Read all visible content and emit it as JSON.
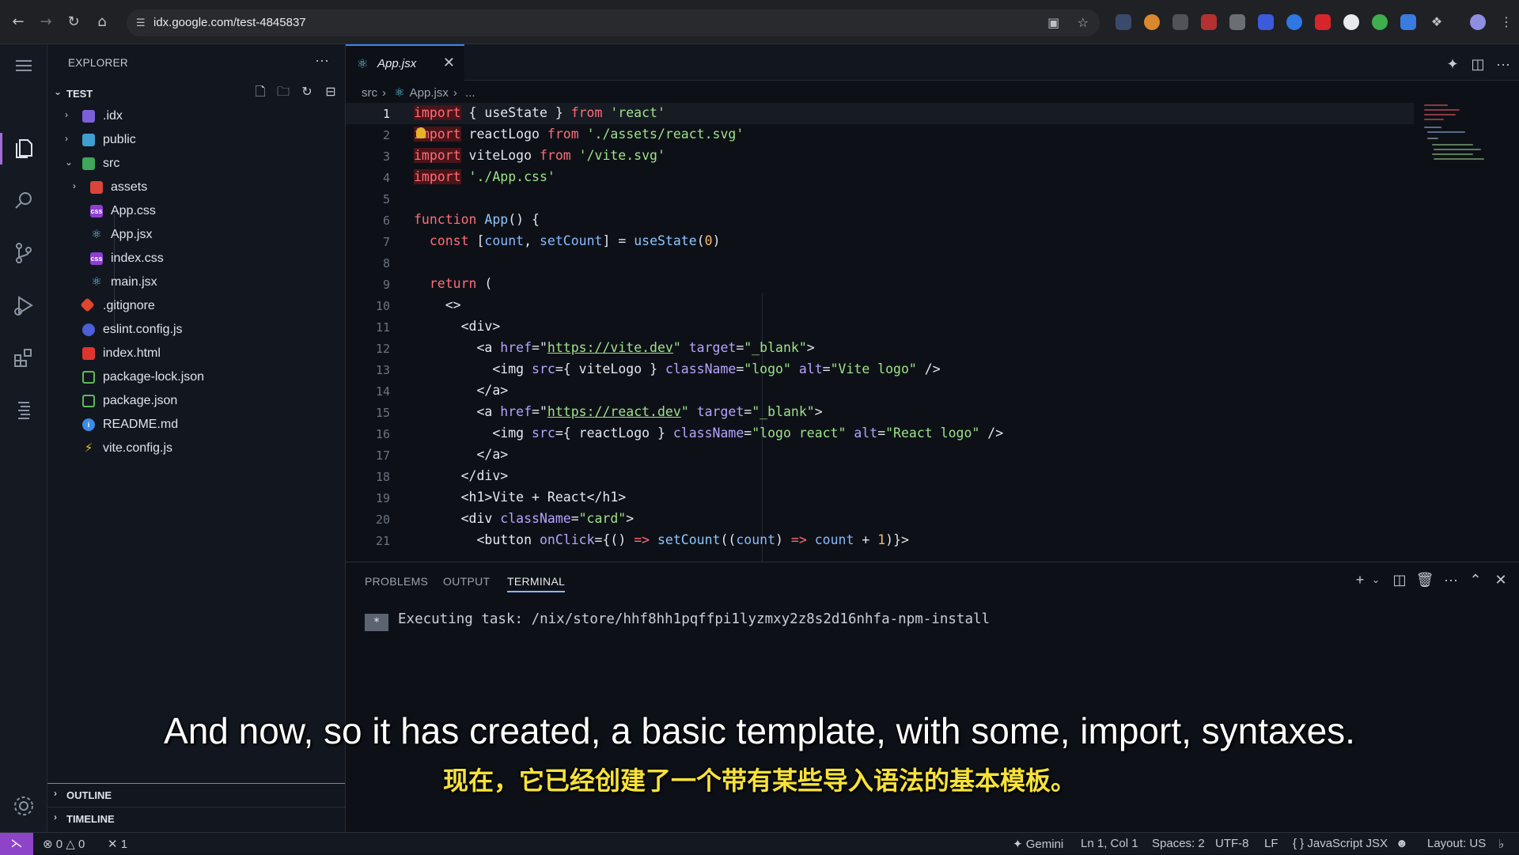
{
  "browser": {
    "url": "idx.google.com/test-4845837"
  },
  "explorer": {
    "title": "EXPLORER",
    "root": "TEST",
    "items": [
      {
        "label": ".idx",
        "type": "folder"
      },
      {
        "label": "public",
        "type": "folder"
      },
      {
        "label": "src",
        "type": "folder-open"
      },
      {
        "label": "assets",
        "type": "folder"
      },
      {
        "label": "App.css",
        "type": "css"
      },
      {
        "label": "App.jsx",
        "type": "react"
      },
      {
        "label": "index.css",
        "type": "css"
      },
      {
        "label": "main.jsx",
        "type": "react"
      },
      {
        "label": ".gitignore",
        "type": "git"
      },
      {
        "label": "eslint.config.js",
        "type": "eslint"
      },
      {
        "label": "index.html",
        "type": "html"
      },
      {
        "label": "package-lock.json",
        "type": "node"
      },
      {
        "label": "package.json",
        "type": "node"
      },
      {
        "label": "README.md",
        "type": "info"
      },
      {
        "label": "vite.config.js",
        "type": "vite"
      }
    ],
    "outline": "OUTLINE",
    "timeline": "TIMELINE"
  },
  "editor": {
    "tab": "App.jsx",
    "breadcrumb": [
      "src",
      "App.jsx",
      "..."
    ],
    "line_numbers": [
      "1",
      "2",
      "3",
      "4",
      "5",
      "6",
      "7",
      "8",
      "9",
      "10",
      "11",
      "12",
      "13",
      "14",
      "15",
      "16",
      "17",
      "18",
      "19",
      "20",
      "21"
    ],
    "strings": {
      "import": "import",
      "from": "from",
      "useState_import": " { useState } ",
      "react": "'react'",
      "reactLogo": " reactLogo ",
      "react_svg": "'./assets/react.svg'",
      "viteLogo": " viteLogo ",
      "vite_svg": "'/vite.svg'",
      "app_css": "'./App.css'",
      "function": "function",
      "App": "App",
      "fn_tail": "() {",
      "const": "const",
      "count": "count",
      "setCount": "setCount",
      "useState": "useState",
      "zero": "0",
      "return": "return",
      "frag": "<>",
      "div_open": "<div>",
      "a": "<a",
      "href": "href",
      "vite_url": "https://vite.dev",
      "react_url": "https://react.dev",
      "target": "target",
      "blank": "\"_blank\"",
      "img": "<img",
      "src": "src",
      "className": "className",
      "alt": "alt",
      "logo": "\"logo\"",
      "logo_react": "\"logo react\"",
      "vite_alt": "\"Vite logo\"",
      "react_alt": "\"React logo\"",
      "a_close": "</a>",
      "div_close": "</div>",
      "h1_text": "<h1>Vite + React</h1>",
      "div_card_open": "<div ",
      "card": "\"card\"",
      "button": "<button",
      "onClick": "onClick",
      "one": "1"
    }
  },
  "panel": {
    "tabs": [
      "PROBLEMS",
      "OUTPUT",
      "TERMINAL"
    ],
    "active_tab": "TERMINAL",
    "terminal_badge": "*",
    "terminal_text": "Executing task: /nix/store/hhf8hh1pqffpi1lyzmxy2z8s2d16nhfa-npm-install"
  },
  "subtitles": {
    "en": "And now, so it has created, a basic template, with some, import, syntaxes.",
    "zh": "现在，它已经创建了一个带有某些导入语法的基本模板。"
  },
  "status": {
    "errors": "0",
    "warnings": "0",
    "ports": "1",
    "gemini": "Gemini",
    "position": "Ln 1, Col 1",
    "spaces": "Spaces: 2",
    "encoding": "UTF-8",
    "eol": "LF",
    "language": "JavaScript JSX",
    "layout": "Layout: US"
  }
}
